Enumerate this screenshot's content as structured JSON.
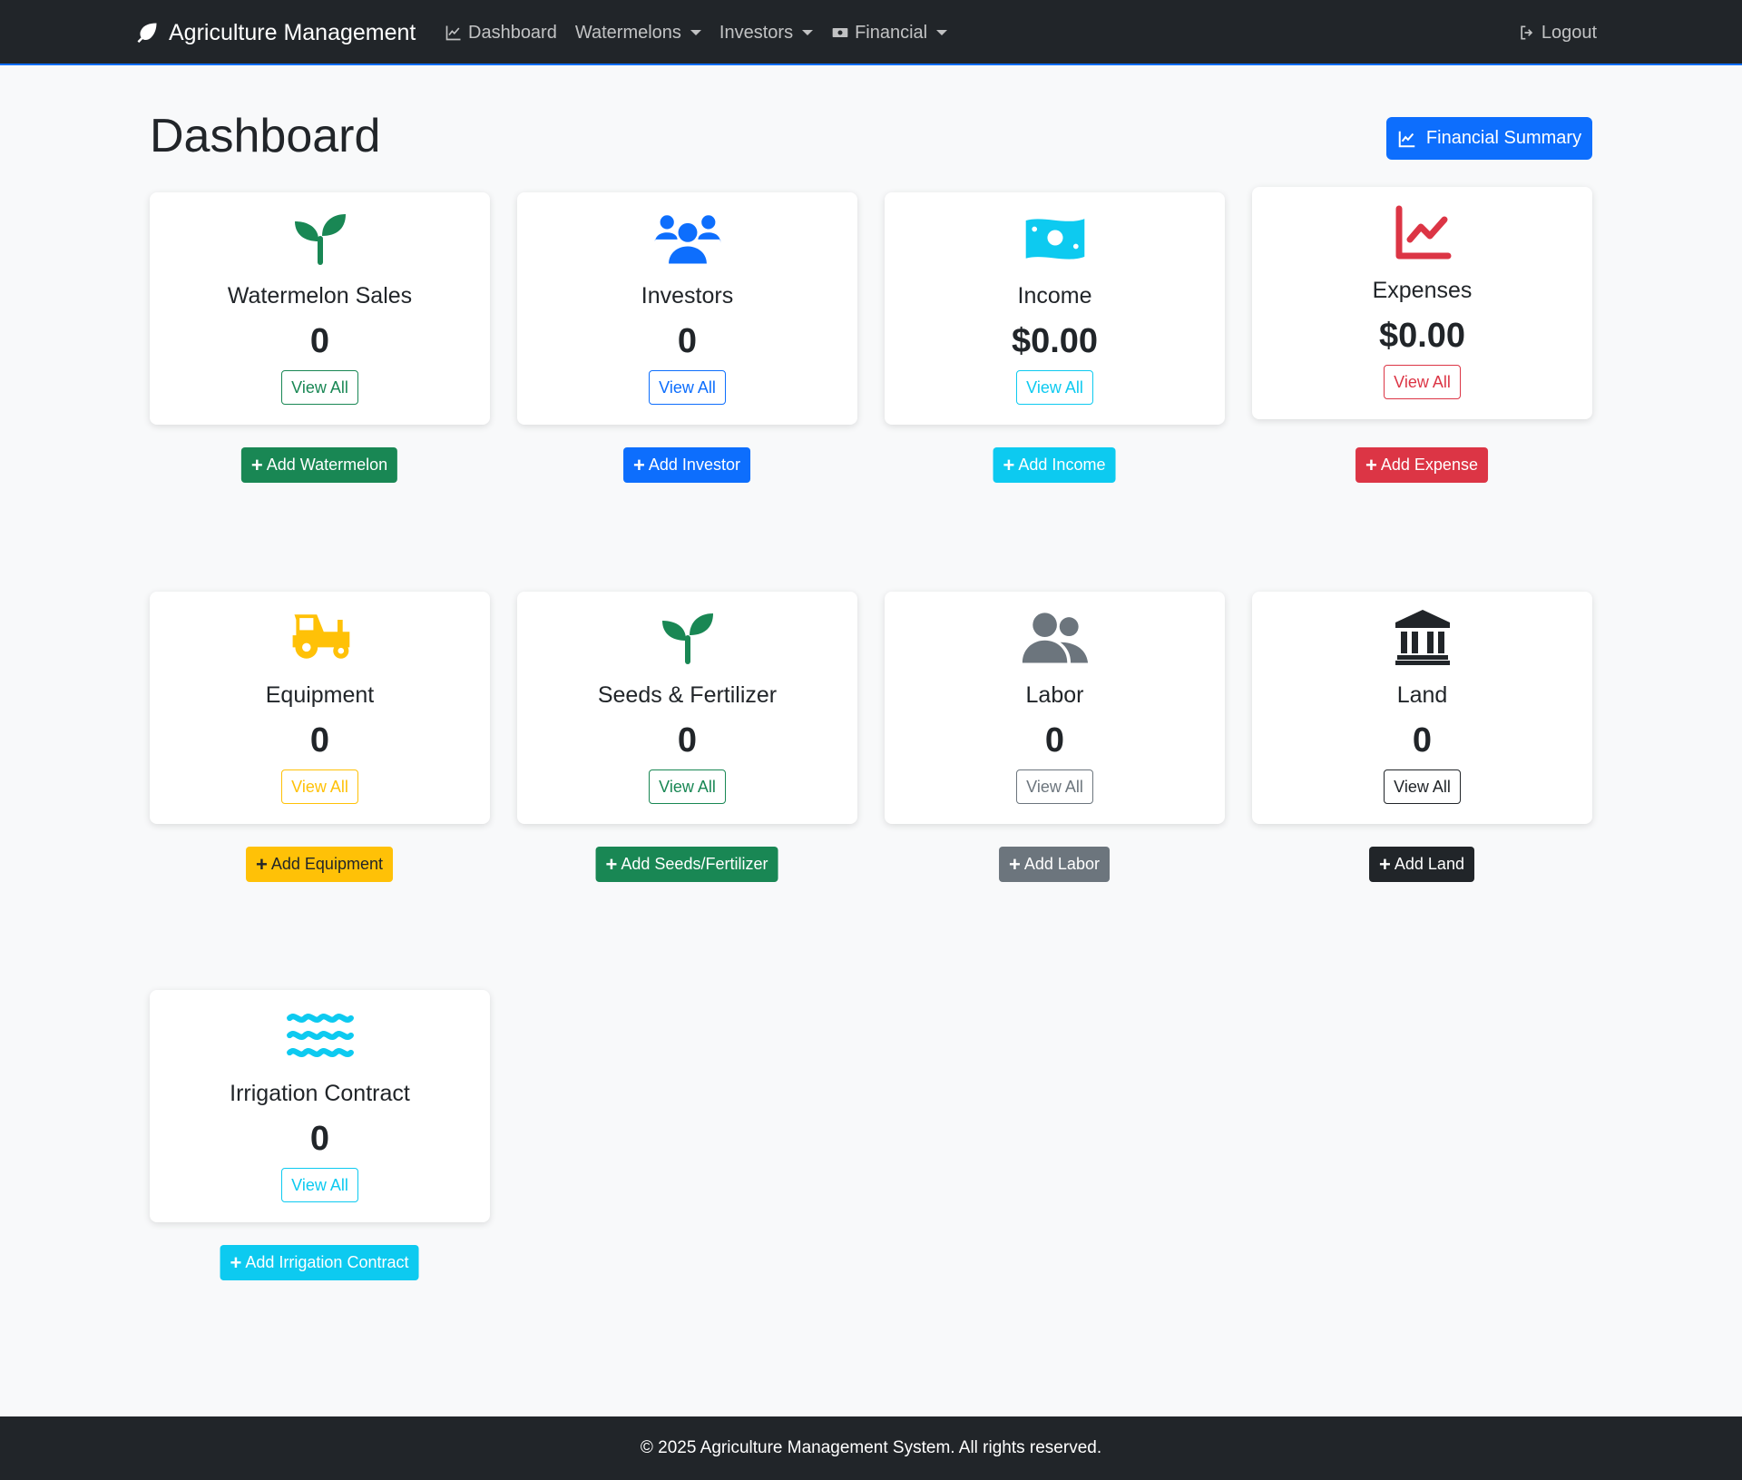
{
  "navbar": {
    "brand": "Agriculture Management",
    "links": [
      {
        "label": "Dashboard"
      },
      {
        "label": "Watermelons"
      },
      {
        "label": "Investors"
      },
      {
        "label": "Financial"
      }
    ],
    "logout": "Logout"
  },
  "header": {
    "title": "Dashboard",
    "summary_button": "Financial Summary"
  },
  "cards": [
    {
      "title": "Watermelon Sales",
      "value": "0",
      "view": "View All",
      "add": "Add Watermelon",
      "icon": "seedling-icon",
      "color": "#198754",
      "view_color": "#198754",
      "add_bg": "#198754",
      "add_fg": "#ffffff"
    },
    {
      "title": "Investors",
      "value": "0",
      "view": "View All",
      "add": "Add Investor",
      "icon": "users-icon",
      "color": "#0d6efd",
      "view_color": "#0d6efd",
      "add_bg": "#0d6efd",
      "add_fg": "#ffffff"
    },
    {
      "title": "Income",
      "value": "$0.00",
      "view": "View All",
      "add": "Add Income",
      "icon": "money-bill-icon",
      "color": "#0dcaf0",
      "view_color": "#0dcaf0",
      "add_bg": "#0dcaf0",
      "add_fg": "#ffffff"
    },
    {
      "title": "Expenses",
      "value": "$0.00",
      "view": "View All",
      "add": "Add Expense",
      "icon": "chart-line-icon",
      "color": "#dc3545",
      "view_color": "#dc3545",
      "add_bg": "#dc3545",
      "add_fg": "#ffffff"
    },
    {
      "title": "Equipment",
      "value": "0",
      "view": "View All",
      "add": "Add Equipment",
      "icon": "tractor-icon",
      "color": "#ffc107",
      "view_color": "#ffc107",
      "add_bg": "#ffc107",
      "add_fg": "#212529"
    },
    {
      "title": "Seeds & Fertilizer",
      "value": "0",
      "view": "View All",
      "add": "Add Seeds/Fertilizer",
      "icon": "seedling-icon",
      "color": "#198754",
      "view_color": "#198754",
      "add_bg": "#198754",
      "add_fg": "#ffffff"
    },
    {
      "title": "Labor",
      "value": "0",
      "view": "View All",
      "add": "Add Labor",
      "icon": "user-group-icon",
      "color": "#6c757d",
      "view_color": "#6c757d",
      "add_bg": "#6c757d",
      "add_fg": "#ffffff"
    },
    {
      "title": "Land",
      "value": "0",
      "view": "View All",
      "add": "Add Land",
      "icon": "landmark-icon",
      "color": "#212529",
      "view_color": "#212529",
      "add_bg": "#212529",
      "add_fg": "#ffffff"
    },
    {
      "title": "Irrigation Contract",
      "value": "0",
      "view": "View All",
      "add": "Add Irrigation Contract",
      "icon": "water-icon",
      "color": "#0dcaf0",
      "view_color": "#0dcaf0",
      "add_bg": "#0dcaf0",
      "add_fg": "#ffffff"
    }
  ],
  "footer": {
    "text": "© 2025 Agriculture Management System. All rights reserved."
  }
}
